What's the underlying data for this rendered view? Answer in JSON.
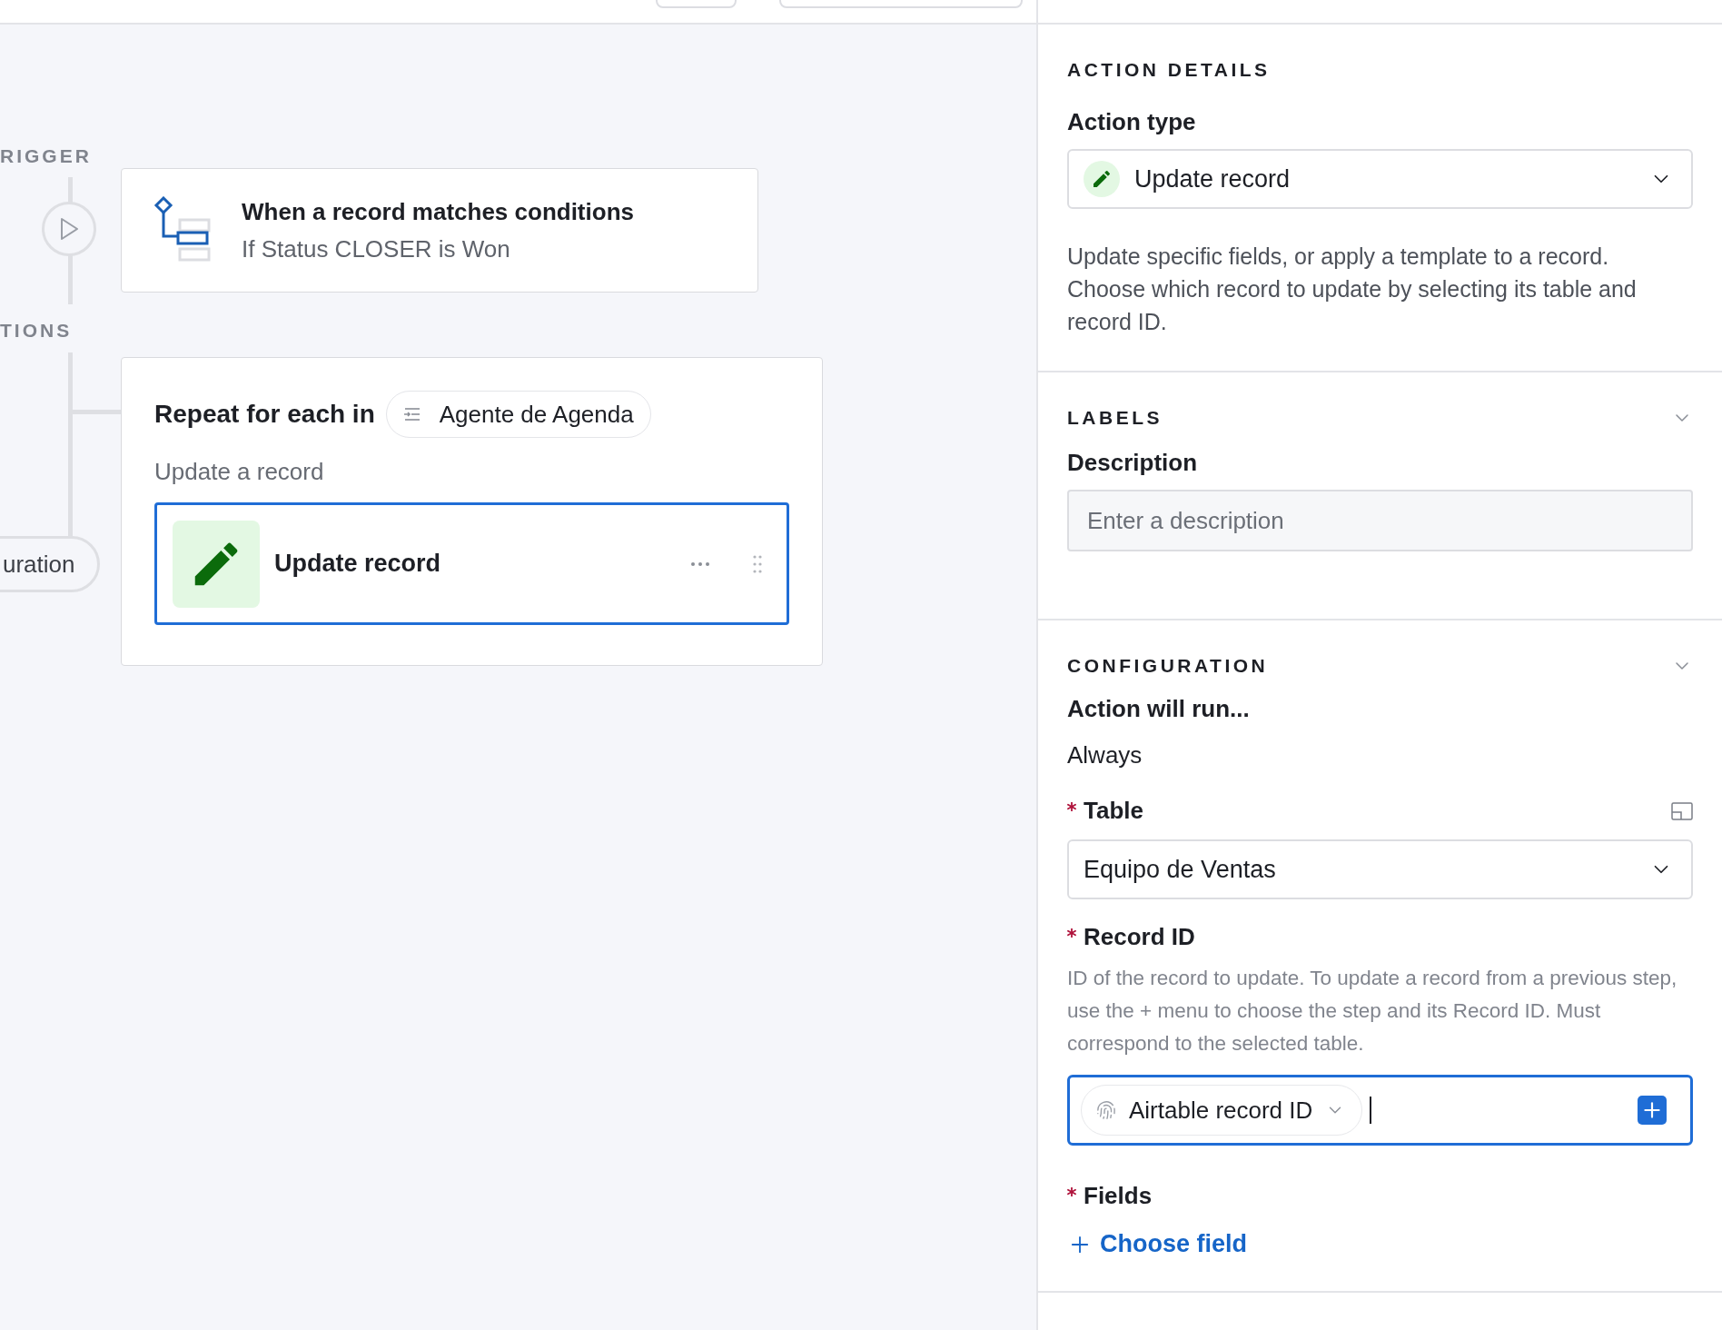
{
  "canvas": {
    "trigger_label": "RIGGER",
    "actions_label": "TIONS",
    "side_pill": "uration",
    "trigger": {
      "title": "When a record matches conditions",
      "subtitle": "If Status CLOSER is Won"
    },
    "action_group": {
      "title": "Repeat for each in",
      "list_chip": "Agente de Agenda",
      "subtitle": "Update a record",
      "steps": [
        {
          "label": "Update record",
          "selected": true
        }
      ]
    }
  },
  "details": {
    "heading": "ACTION DETAILS",
    "action_type_label": "Action type",
    "action_type_value": "Update record",
    "description": "Update specific fields, or apply a template to a record. Choose which record to update by selecting its table and record ID."
  },
  "labels": {
    "heading": "LABELS",
    "expanded": true,
    "description_label": "Description",
    "description_placeholder": "Enter a description"
  },
  "configuration": {
    "heading": "CONFIGURATION",
    "expanded": true,
    "run_label": "Action will run...",
    "run_value": "Always",
    "table": {
      "label": "Table",
      "required": true,
      "value": "Equipo de Ventas"
    },
    "record_id": {
      "label": "Record ID",
      "required": true,
      "help": "ID of the record to update. To update a record from a previous step, use the + menu to choose the step and its Record ID. Must correspond to the selected table.",
      "token": "Airtable record ID",
      "focused": true
    },
    "fields": {
      "label": "Fields",
      "required": true,
      "add_link": "Choose field"
    }
  }
}
